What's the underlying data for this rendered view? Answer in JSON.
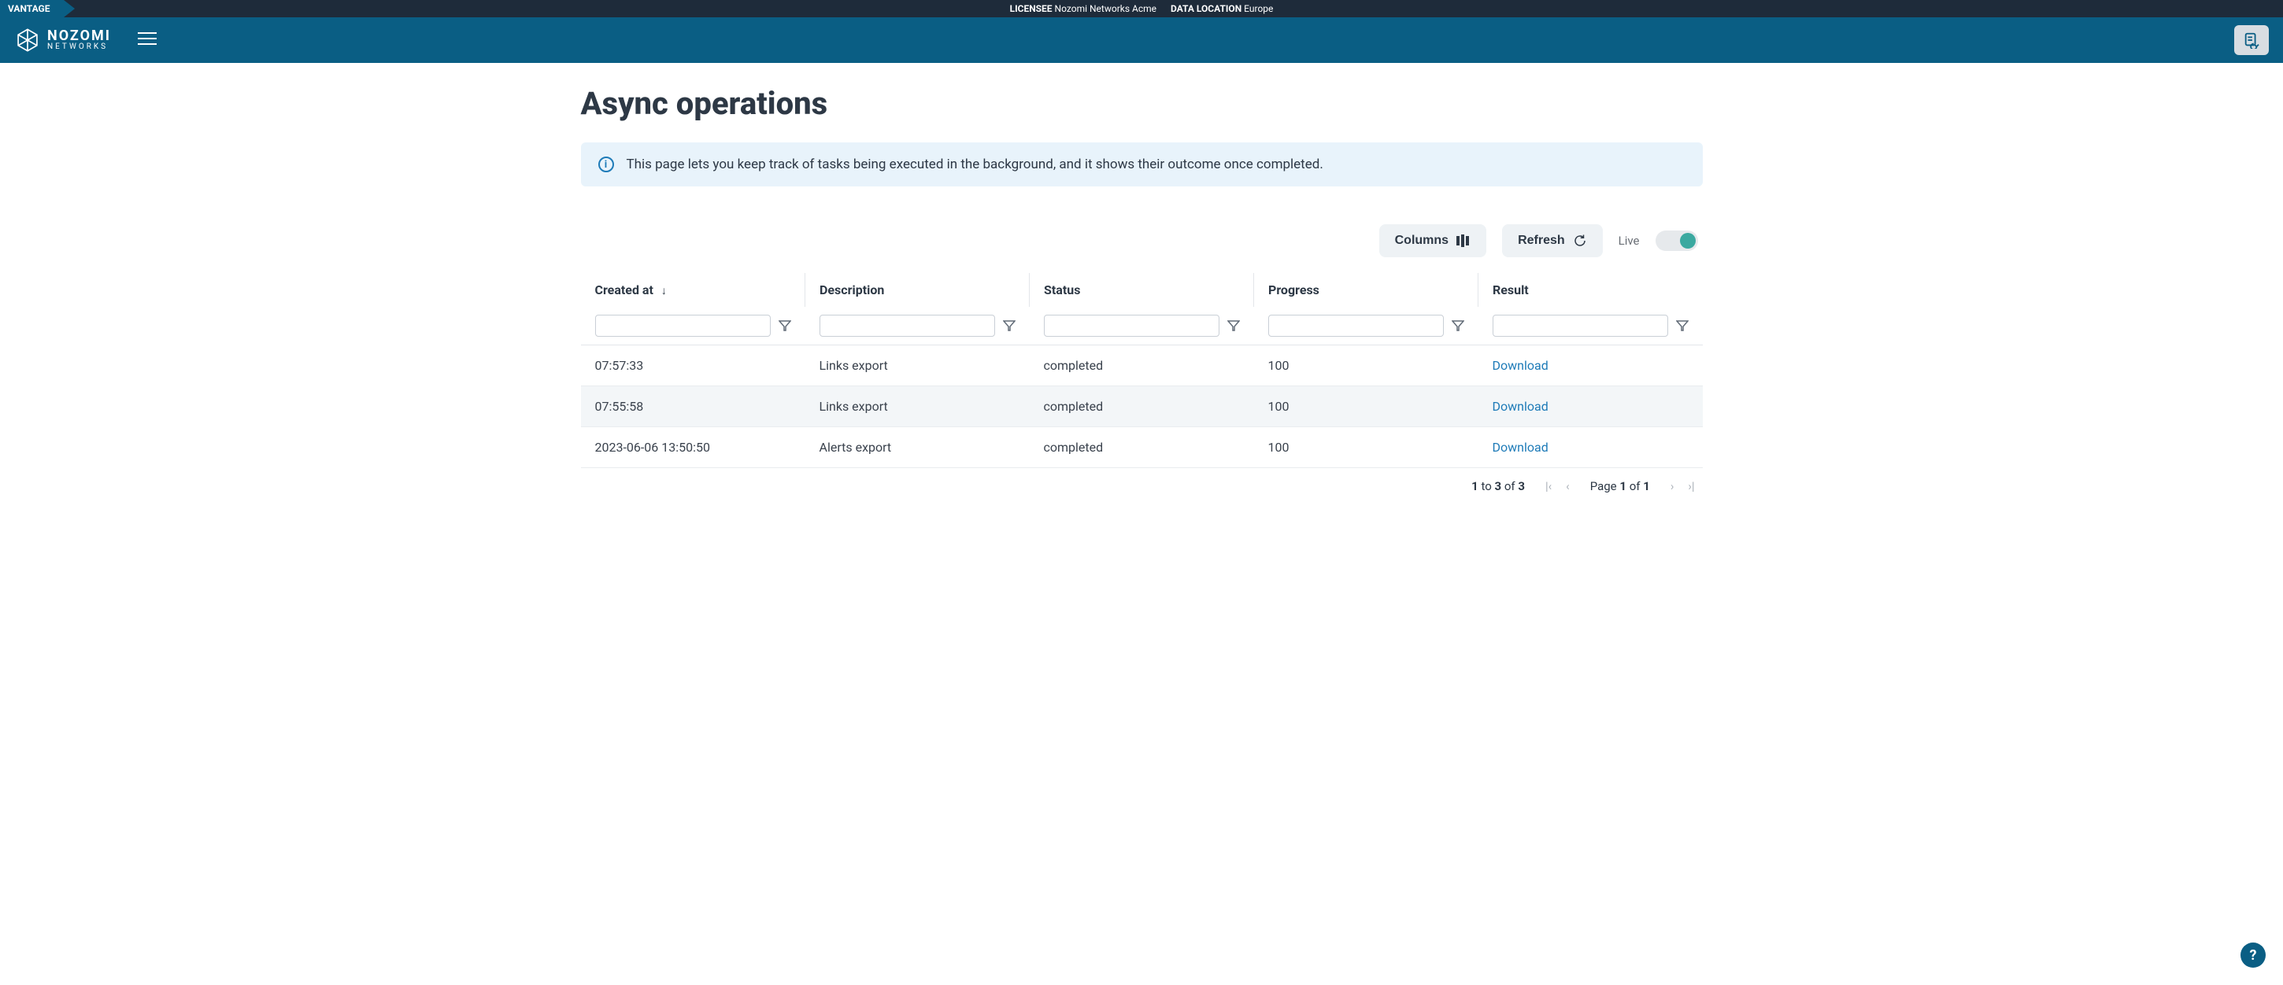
{
  "topbar": {
    "brand": "VANTAGE",
    "licensee_label": "LICENSEE",
    "licensee_value": "Nozomi Networks Acme",
    "location_label": "DATA LOCATION",
    "location_value": "Europe"
  },
  "logo": {
    "line1": "NOZOMI",
    "line2": "NETWORKS"
  },
  "page": {
    "title": "Async operations",
    "info": "This page lets you keep track of tasks being executed in the background, and it shows their outcome once completed."
  },
  "controls": {
    "columns": "Columns",
    "refresh": "Refresh",
    "live": "Live"
  },
  "columns": [
    "Created at",
    "Description",
    "Status",
    "Progress",
    "Result"
  ],
  "rows": [
    {
      "created": "07:57:33",
      "desc": "Links export",
      "status": "completed",
      "progress": "100",
      "result": "Download"
    },
    {
      "created": "07:55:58",
      "desc": "Links export",
      "status": "completed",
      "progress": "100",
      "result": "Download"
    },
    {
      "created": "2023-06-06 13:50:50",
      "desc": "Alerts export",
      "status": "completed",
      "progress": "100",
      "result": "Download"
    }
  ],
  "pager": {
    "range_from": "1",
    "range_to": "3",
    "range_total": "3",
    "to_word": "to",
    "of_word": "of",
    "page_word": "Page",
    "page_cur": "1",
    "page_total": "1"
  },
  "help": "?"
}
